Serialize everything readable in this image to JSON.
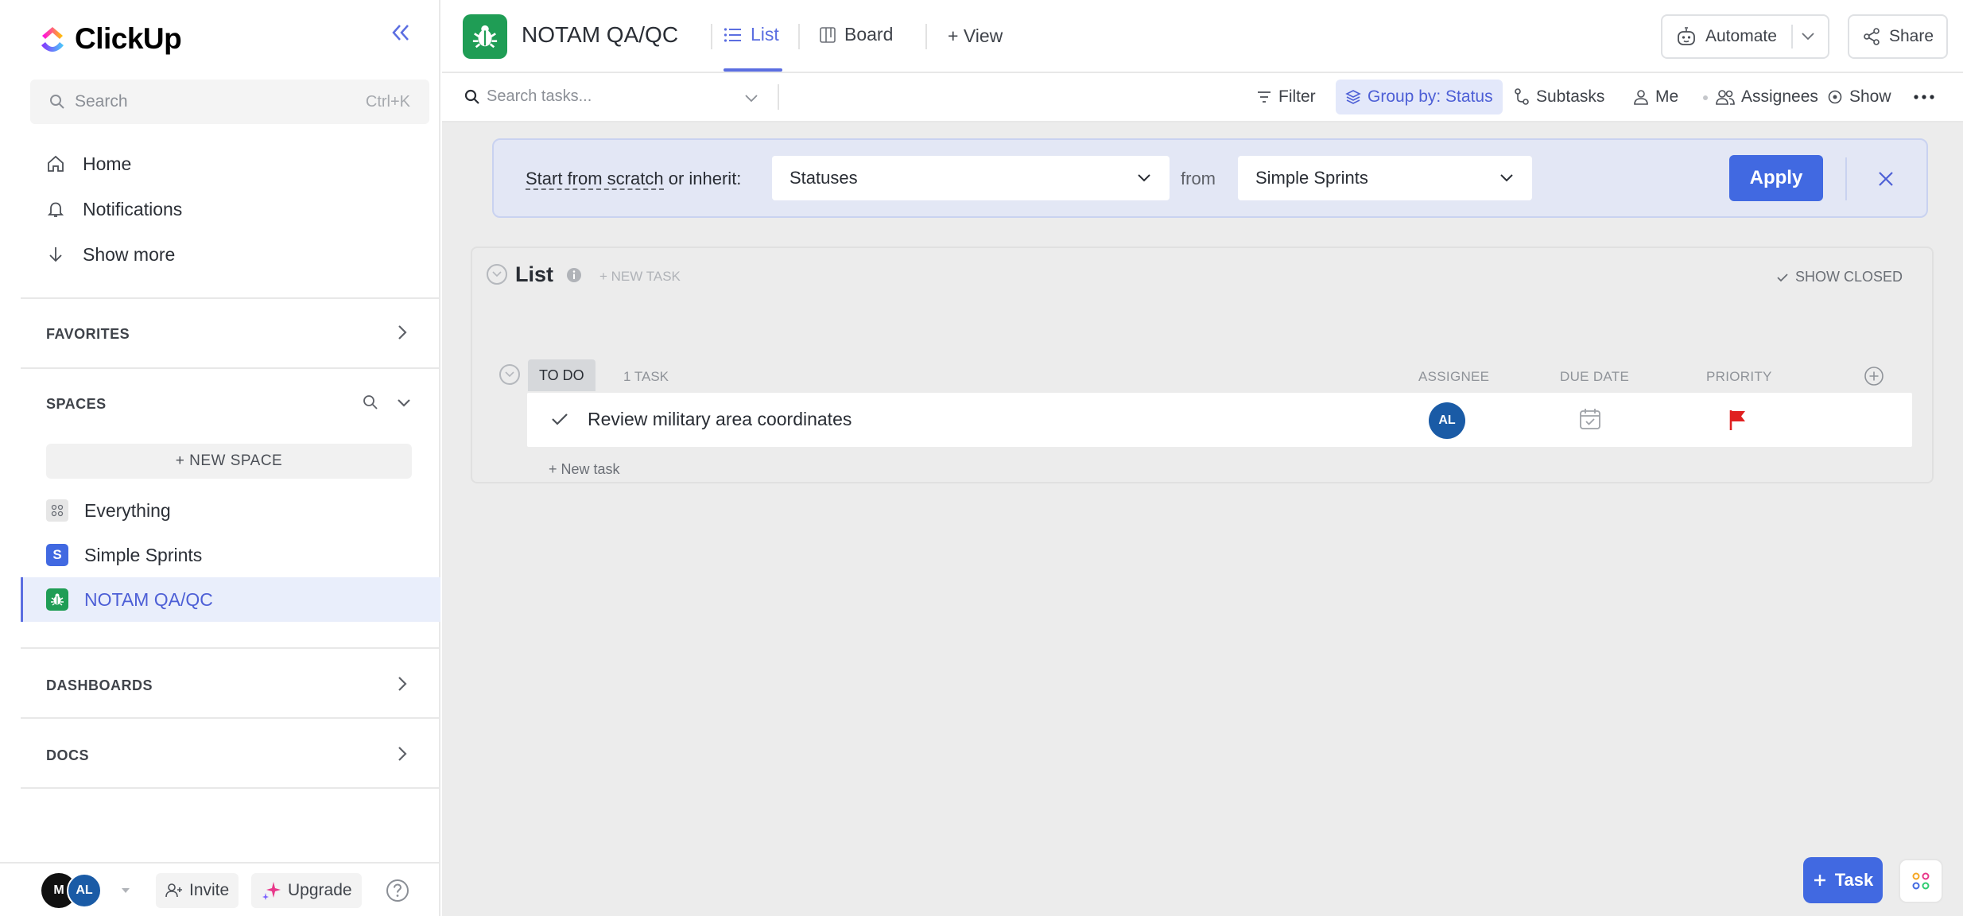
{
  "app": {
    "brand": "ClickUp",
    "colors": {
      "accent": "#5b6ee1",
      "primary_button": "#4169e1",
      "project_green": "#1f9d55",
      "priority_red": "#e02020",
      "avatar_blue": "#1a5ba6",
      "avatar_black": "#111111"
    }
  },
  "sidebar": {
    "search": {
      "placeholder": "Search",
      "shortcut": "Ctrl+K"
    },
    "nav": [
      {
        "label": "Home",
        "icon": "home-icon"
      },
      {
        "label": "Notifications",
        "icon": "bell-icon"
      },
      {
        "label": "Show more",
        "icon": "arrow-down-icon"
      }
    ],
    "favorites": {
      "label": "FAVORITES"
    },
    "spaces": {
      "label": "SPACES",
      "new_space": "+ NEW SPACE",
      "items": [
        {
          "label": "Everything",
          "icon": "grid-icon"
        },
        {
          "label": "Simple Sprints",
          "badge": "S"
        },
        {
          "label": "NOTAM QA/QC",
          "icon": "bug-icon",
          "active": true
        }
      ]
    },
    "dashboards": {
      "label": "DASHBOARDS"
    },
    "docs": {
      "label": "DOCS"
    },
    "bottom": {
      "avatars": [
        "M",
        "AL"
      ],
      "invite": "Invite",
      "upgrade": "Upgrade"
    }
  },
  "topbar": {
    "project": "NOTAM QA/QC",
    "tabs": [
      {
        "label": "List",
        "active": true
      },
      {
        "label": "Board",
        "active": false
      }
    ],
    "add_view": "+ View",
    "automate": "Automate",
    "share": "Share"
  },
  "subbar": {
    "search_placeholder": "Search tasks...",
    "filter": "Filter",
    "group_by": "Group by: Status",
    "subtasks": "Subtasks",
    "me": "Me",
    "assignees": "Assignees",
    "show": "Show"
  },
  "banner": {
    "link": "Start from scratch",
    "text": " or inherit:",
    "statuses": "Statuses",
    "from": "from",
    "source": "Simple Sprints",
    "apply": "Apply"
  },
  "list": {
    "title": "List",
    "new_task": "+ NEW TASK",
    "show_closed": "SHOW CLOSED",
    "group": {
      "status": "TO DO",
      "count": "1 TASK",
      "columns": {
        "assignee": "ASSIGNEE",
        "due_date": "DUE DATE",
        "priority": "PRIORITY"
      }
    },
    "tasks": [
      {
        "name": "Review military area coordinates",
        "assignee": "AL"
      }
    ],
    "add_task": "+ New task"
  },
  "fab": {
    "task": "Task"
  }
}
